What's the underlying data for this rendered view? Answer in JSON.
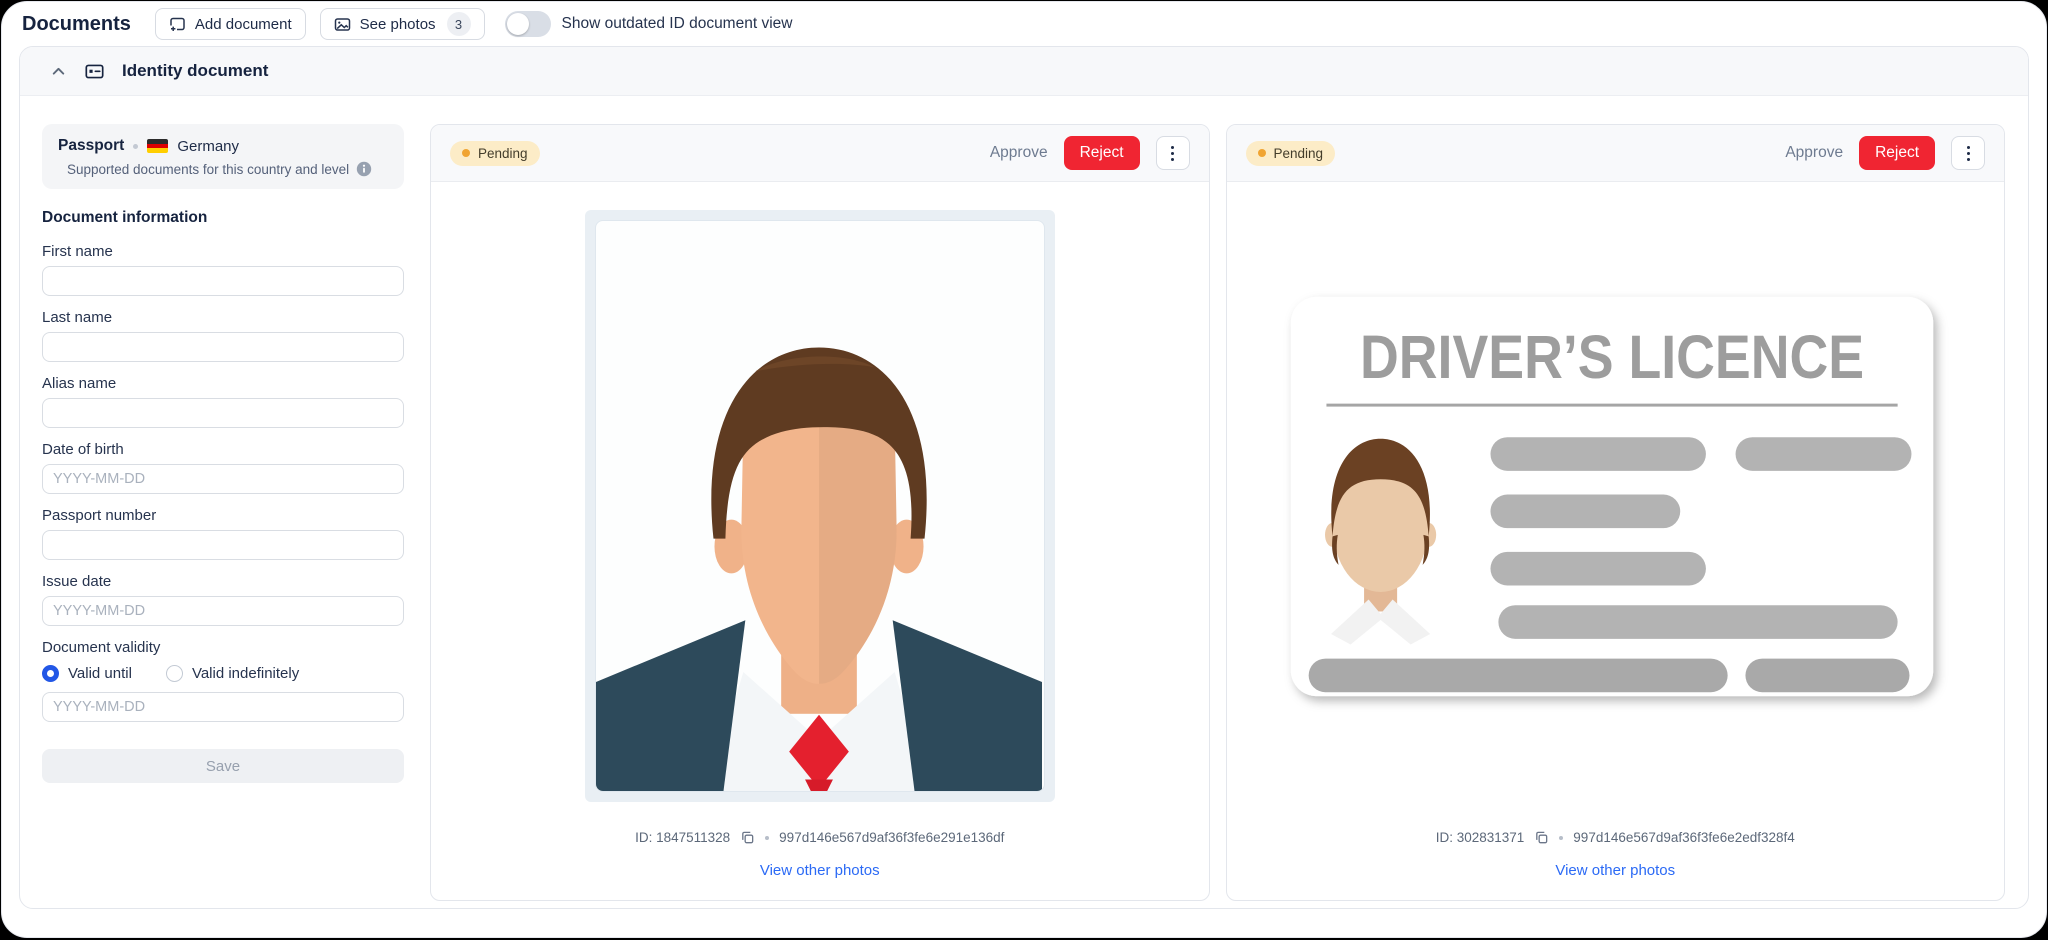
{
  "topbar": {
    "title": "Documents",
    "add_document_label": "Add document",
    "see_photos_label": "See photos",
    "see_photos_count": "3",
    "toggle_label": "Show outdated ID document view"
  },
  "section": {
    "title": "Identity document"
  },
  "panel": {
    "doc_type": "Passport",
    "country": "Germany",
    "subtitle": "Supported documents for this country and level",
    "form_title": "Document information",
    "first_name_label": "First name",
    "last_name_label": "Last name",
    "alias_name_label": "Alias name",
    "dob_label": "Date of birth",
    "passport_number_label": "Passport number",
    "issue_date_label": "Issue date",
    "validity_label": "Document validity",
    "valid_until_label": "Valid until",
    "valid_indefinitely_label": "Valid indefinitely",
    "date_placeholder": "YYYY-MM-DD",
    "save_label": "Save"
  },
  "documents": [
    {
      "status": "Pending",
      "approve_label": "Approve",
      "reject_label": "Reject",
      "id_text": "ID: 1847511328",
      "hash": "997d146e567d9af36f3fe6e291e136df",
      "link_label": "View other photos"
    },
    {
      "status": "Pending",
      "approve_label": "Approve",
      "reject_label": "Reject",
      "id_text": "ID: 302831371",
      "hash": "997d146e567d9af36f3fe6e2edf328f4",
      "link_label": "View other photos",
      "image_title": "DRIVER’S LICENCE"
    }
  ],
  "colors": {
    "reject_red": "#f02532",
    "link_blue": "#2b6af5",
    "radio_blue": "#2257e6",
    "pending_bg": "#fcecc7",
    "pending_dot": "#f0a432"
  }
}
